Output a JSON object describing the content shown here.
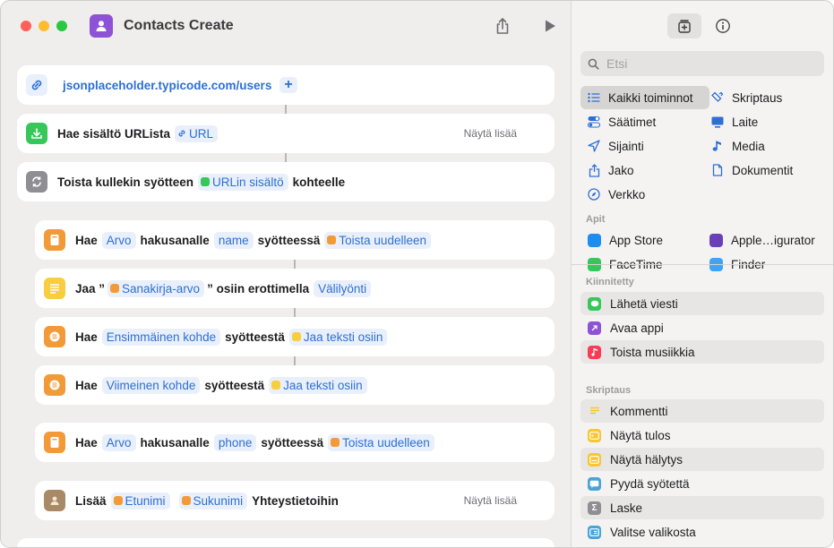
{
  "window": {
    "title": "Contacts Create"
  },
  "actions": {
    "url": {
      "value": "jsonplaceholder.typicode.com/users",
      "add": "+"
    },
    "get_contents": {
      "label": "Hae sisältö URLista",
      "var": "URL",
      "show_more": "Näytä lisää"
    },
    "repeat": {
      "prefix": "Toista kullekin syötteen",
      "var": "URLin sisältö",
      "suffix": "kohteelle"
    },
    "get_value_name": {
      "verb": "Hae",
      "token1": "Arvo",
      "mid": "hakusanalle",
      "token2": "name",
      "mid2": "syötteessä",
      "var": "Toista uudelleen"
    },
    "split_text": {
      "verb": "Jaa ”",
      "var": "Sanakirja-arvo",
      "mid": "” osiin erottimella",
      "token": "Välilyönti"
    },
    "get_first": {
      "verb": "Hae",
      "token": "Ensimmäinen kohde",
      "mid": "syötteestä",
      "var": "Jaa teksti osiin"
    },
    "get_last": {
      "verb": "Hae",
      "token": "Viimeinen kohde",
      "mid": "syötteestä",
      "var": "Jaa teksti osiin"
    },
    "get_value_phone": {
      "verb": "Hae",
      "token1": "Arvo",
      "mid": "hakusanalle",
      "token2": "phone",
      "mid2": "syötteessä",
      "var": "Toista uudelleen"
    },
    "add_contact": {
      "verb": "Lisää",
      "var1": "Etunimi",
      "var2": "Sukunimi",
      "suffix": "Yhteystietoihin",
      "show_more": "Näytä lisää"
    }
  },
  "sidebar": {
    "search_placeholder": "Etsi",
    "categories": [
      {
        "label": "Kaikki toiminnot",
        "icon": "list-icon",
        "selected": true
      },
      {
        "label": "Skriptaus",
        "icon": "scripting-icon"
      },
      {
        "label": "Säätimet",
        "icon": "toggle-icon"
      },
      {
        "label": "Laite",
        "icon": "display-icon"
      },
      {
        "label": "Sijainti",
        "icon": "location-icon"
      },
      {
        "label": "Media",
        "icon": "music-note-icon"
      },
      {
        "label": "Jako",
        "icon": "share-icon"
      },
      {
        "label": "Dokumentit",
        "icon": "document-icon"
      },
      {
        "label": "Verkko",
        "icon": "compass-icon"
      }
    ],
    "apps_header": "Apit",
    "apps": [
      "App Store",
      "Apple…igurator",
      "FaceTime",
      "Finder"
    ],
    "pinned_header": "Kiinnitetty",
    "pinned": [
      "Lähetä viesti",
      "Avaa appi",
      "Toista musiikkia"
    ],
    "scripting_header": "Skriptaus",
    "scripting": [
      "Kommentti",
      "Näytä tulos",
      "Näytä hälytys",
      "Pyydä syötettä",
      "Laske",
      "Valitse valikosta"
    ]
  },
  "colors": {
    "accent": "#2d6fd6",
    "app_icon": "#8e52d6"
  }
}
